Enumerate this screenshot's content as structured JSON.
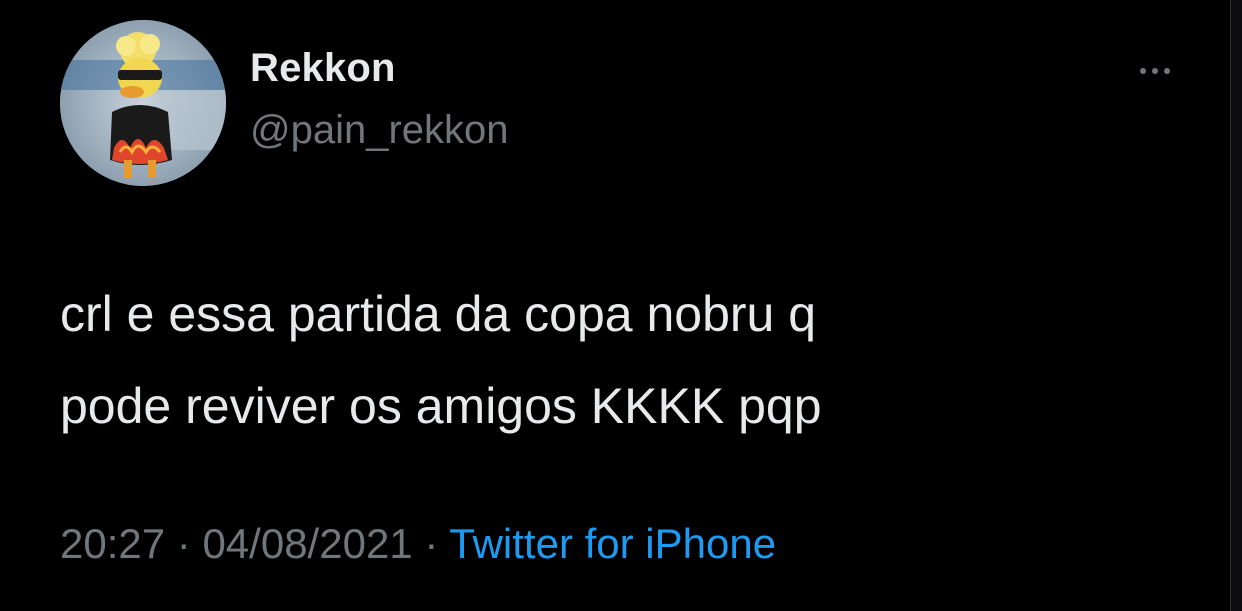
{
  "tweet": {
    "display_name": "Rekkon",
    "handle": "@pain_rekkon",
    "more_icon": "more-horizontal-icon",
    "text": "crl e essa partida da copa nobru q\npode reviver os amigos KKKK pqp",
    "time": "20:27",
    "separator": "·",
    "date": "04/08/2021",
    "source": "Twitter for iPhone"
  },
  "colors": {
    "background": "#000000",
    "primary_text": "#e7e9ea",
    "secondary_text": "#71767b",
    "link": "#1d9bf0"
  }
}
